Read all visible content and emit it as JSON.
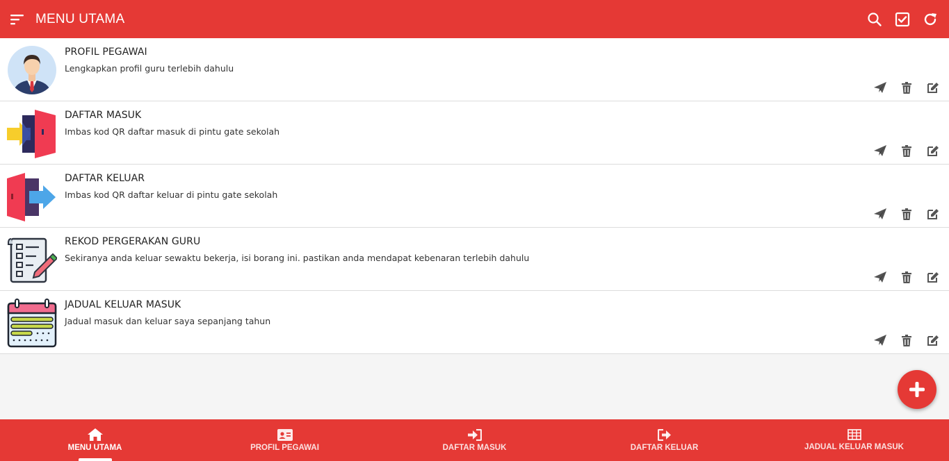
{
  "header": {
    "title": "MENU UTAMA",
    "accent_color": "#e53935",
    "actions": [
      "search-icon",
      "checkbox-icon",
      "refresh-icon"
    ]
  },
  "items": [
    {
      "title": "PROFIL PEGAWAI",
      "desc": "Lengkapkan profil guru terlebih dahulu",
      "icon": "employee-avatar-icon"
    },
    {
      "title": "DAFTAR MASUK",
      "desc": "Imbas kod QR daftar masuk di pintu gate sekolah",
      "icon": "door-enter-icon"
    },
    {
      "title": "DAFTAR KELUAR",
      "desc": "Imbas kod QR daftar keluar di pintu gate sekolah",
      "icon": "door-exit-icon"
    },
    {
      "title": "REKOD PERGERAKAN GURU",
      "desc": "Sekiranya anda keluar sewaktu bekerja, isi borang ini. pastikan anda mendapat kebenaran terlebih dahulu",
      "icon": "checklist-icon"
    },
    {
      "title": "JADUAL KELUAR MASUK",
      "desc": "Jadual masuk dan keluar saya sepanjang tahun",
      "icon": "calendar-icon"
    }
  ],
  "item_actions": [
    "send-icon",
    "trash-icon",
    "edit-icon"
  ],
  "fab": {
    "icon": "plus-icon"
  },
  "bottom_nav": [
    {
      "label": "MENU UTAMA",
      "icon": "home-icon",
      "active": true
    },
    {
      "label": "PROFIL PEGAWAI",
      "icon": "id-card-icon",
      "active": false
    },
    {
      "label": "DAFTAR MASUK",
      "icon": "sign-in-icon",
      "active": false
    },
    {
      "label": "DAFTAR KELUAR",
      "icon": "sign-out-icon",
      "active": false
    },
    {
      "label": "JADUAL KELUAR MASUK",
      "icon": "table-icon",
      "active": false
    }
  ]
}
